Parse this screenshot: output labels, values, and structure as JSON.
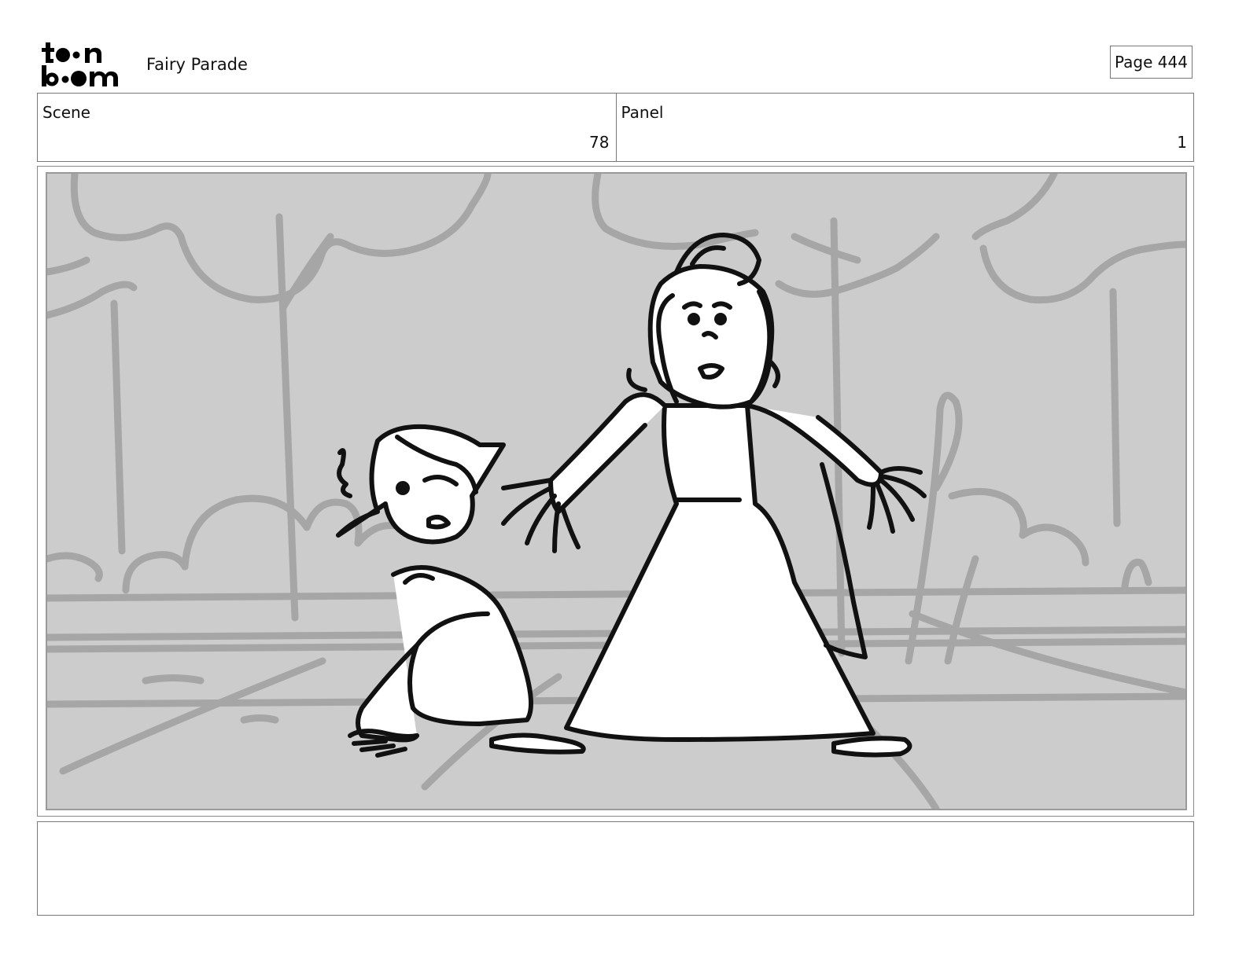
{
  "header": {
    "logo_line1": "toon",
    "logo_line2": "boom",
    "project_title": "Fairy Parade",
    "page_label": "Page 444"
  },
  "info": {
    "scene_label": "Scene",
    "scene_value": "78",
    "panel_label": "Panel",
    "panel_value": "1"
  },
  "panel": {
    "image": "storyboard-sketch",
    "background_color": "#cccccc",
    "bg_line_color": "#a6a6a6",
    "ink_color": "#111111"
  },
  "notes": {
    "text": ""
  }
}
